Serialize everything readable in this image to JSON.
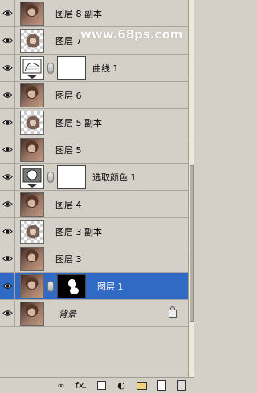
{
  "watermark": "www.68ps.com",
  "layers": [
    {
      "label": "图层 8 副本",
      "type": "photo"
    },
    {
      "label": "图层 7",
      "type": "checker"
    },
    {
      "label": "曲线 1",
      "type": "adjustment-curves"
    },
    {
      "label": "图层 6",
      "type": "photo"
    },
    {
      "label": "图层 5 副本",
      "type": "checker"
    },
    {
      "label": "图层 5",
      "type": "photo"
    },
    {
      "label": "选取颜色 1",
      "type": "adjustment-selective"
    },
    {
      "label": "图层 4",
      "type": "photo"
    },
    {
      "label": "图层 3 副本",
      "type": "checker"
    },
    {
      "label": "图层 3",
      "type": "photo"
    },
    {
      "label": "图层 1",
      "type": "photo-mask",
      "selected": true
    },
    {
      "label": "背景",
      "type": "background",
      "locked": true
    }
  ],
  "toolbar": {
    "link_icon": "link-icon",
    "fx_label": "fx.",
    "mask_icon": "mask-icon",
    "adjust_icon": "adjustment-layer-icon",
    "group_icon": "folder-icon",
    "new_layer_icon": "new-layer-icon",
    "delete_icon": "trash-icon"
  },
  "colors": {
    "panel": "#d4d0c8",
    "selected": "#316ac5",
    "watermark": "#ffffff"
  }
}
